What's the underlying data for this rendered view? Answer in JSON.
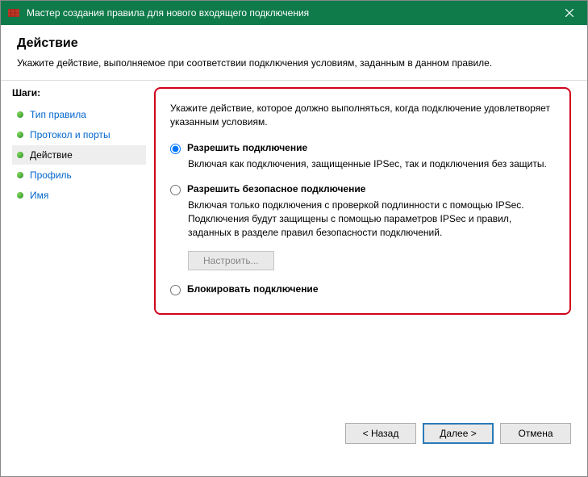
{
  "window": {
    "title": "Мастер создания правила для нового входящего подключения"
  },
  "header": {
    "heading": "Действие",
    "subtitle": "Укажите действие, выполняемое при соответствии подключения условиям, заданным в данном правиле."
  },
  "steps": {
    "heading": "Шаги:",
    "items": [
      {
        "label": "Тип правила",
        "active": false
      },
      {
        "label": "Протокол и порты",
        "active": false
      },
      {
        "label": "Действие",
        "active": true
      },
      {
        "label": "Профиль",
        "active": false
      },
      {
        "label": "Имя",
        "active": false
      }
    ]
  },
  "content": {
    "instruction": "Укажите действие, которое должно выполняться, когда подключение удовлетворяет указанным условиям.",
    "options": {
      "allow": {
        "label": "Разрешить подключение",
        "desc": "Включая как подключения, защищенные IPSec, так и подключения без защиты."
      },
      "allow_secure": {
        "label": "Разрешить безопасное подключение",
        "desc": "Включая только подключения с проверкой подлинности с помощью IPSec. Подключения будут защищены с помощью параметров IPSec и правил, заданных в разделе правил безопасности подключений.",
        "configure_btn": "Настроить..."
      },
      "block": {
        "label": "Блокировать подключение"
      }
    }
  },
  "buttons": {
    "back": "< Назад",
    "next": "Далее >",
    "cancel": "Отмена"
  }
}
